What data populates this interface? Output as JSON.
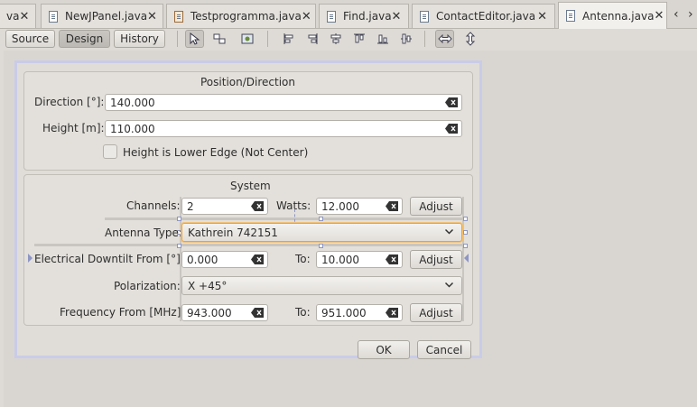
{
  "tabs": [
    {
      "label": "va",
      "icon": "java-file-icon"
    },
    {
      "label": "NewJPanel.java",
      "icon": "java-file-icon"
    },
    {
      "label": "Testprogramma.java",
      "icon": "form-file-icon"
    },
    {
      "label": "Find.java",
      "icon": "java-file-icon"
    },
    {
      "label": "ContactEditor.java",
      "icon": "java-file-icon"
    },
    {
      "label": "Antenna.java",
      "icon": "java-file-icon",
      "active": true
    }
  ],
  "close_glyph": "✕",
  "nav": {
    "left": "‹",
    "right": "›"
  },
  "toolbar": {
    "source": "Source",
    "design": "Design",
    "history": "History"
  },
  "position_panel": {
    "title": "Position/Direction",
    "direction_label": "Direction [°]:",
    "direction_value": "140.000",
    "height_label": "Height [m]:",
    "height_value": "110.000",
    "lower_edge_label": "Height is Lower Edge (Not Center)",
    "lower_edge_checked": false
  },
  "system_panel": {
    "title": "System",
    "channels_label": "Channels:",
    "channels_value": "2",
    "watts_label": "Watts:",
    "watts_value": "12.000",
    "adjust_label": "Adjust",
    "antenna_type_label": "Antenna Type:",
    "antenna_type_value": "Kathrein 742151",
    "downtilt_label": "Electrical Downtilt From [°]:",
    "downtilt_from": "0.000",
    "to_label": "To:",
    "downtilt_to": "10.000",
    "polarization_label": "Polarization:",
    "polarization_value": "X +45°",
    "freq_label": "Frequency From [MHz]:",
    "freq_from": "943.000",
    "freq_to": "951.000"
  },
  "dialog": {
    "ok": "OK",
    "cancel": "Cancel"
  },
  "colors": {
    "focus": "#e8a33b",
    "selection": "#c9cce8"
  }
}
